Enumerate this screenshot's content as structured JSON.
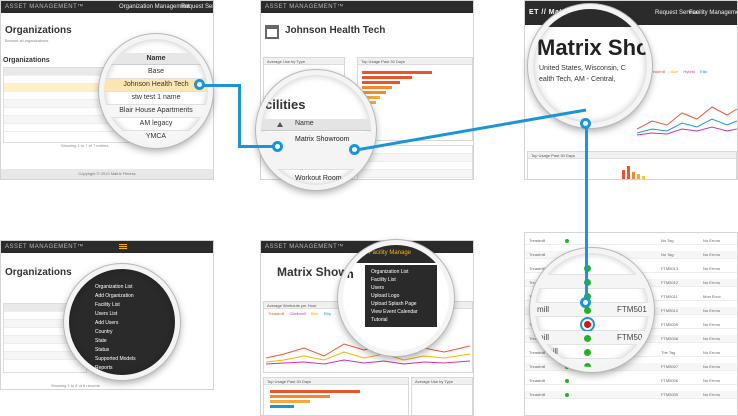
{
  "brand": "ASSET MANAGEMENT™",
  "accent": "#1c95d4",
  "panel1": {
    "title": "Organizations",
    "subtitle": "Browse all organizations",
    "table_title": "Organizations",
    "footer": "Copyright © 2013 Matrix Fitness",
    "showing": "Showing 1 to 7 of 7 entries",
    "nav": [
      "Organization Management",
      "Request Service"
    ],
    "lens": {
      "header": "Name",
      "items": [
        "Base",
        "Johnson Health Tech",
        "stw test 1 name",
        "Blair House Apartments",
        "AM legacy",
        "YMCA"
      ]
    }
  },
  "panel2": {
    "title": "Johnson Health Tech",
    "card1": "Average Use by Type",
    "card2": "Top Usage Past 30 Days",
    "lens": {
      "heading": "cilities",
      "col": "Name",
      "items": [
        "Matrix Showroom",
        "Workout Room"
      ]
    }
  },
  "panel3": {
    "crumb": "ET // Matrix Showroom",
    "nav": [
      "Request Service",
      "Facility Management"
    ],
    "card": "Top Usage Past 30 Days",
    "legend": [
      "Treadmill",
      "Bike",
      "Hybrid",
      "Ellip"
    ],
    "lens": {
      "title": "Matrix Sho",
      "line1": "United States, Wisconsin, C",
      "line2": "ealth Tech, AM - Central,"
    }
  },
  "panel4": {
    "title": "Organizations",
    "showing": "Showing 1 to 8 of 8 records",
    "menu": [
      "Organization List",
      "Add Organization",
      "Facility List",
      "Users List",
      "Add Users",
      "Country",
      "State",
      "Status",
      "Supported Models",
      "Reports"
    ]
  },
  "panel5": {
    "title": "Matrix Showroom",
    "card1": "Average Workouts per Hour",
    "card2": "Top Usage Past 30 Days",
    "card3": "Average Use by Type",
    "legend": [
      "Treadmill",
      "Climbmill",
      "Bike",
      "Ellip"
    ],
    "nav_partial": "ce",
    "nav_active": "Facility Manage",
    "menu": [
      "Organization List",
      "Facility List",
      "Users",
      "Upload Logo",
      "Upload Splash Page",
      "View Event Calendar",
      "Tutorial"
    ]
  },
  "panel6": {
    "rows": [
      {
        "type": "Treadmill",
        "tag": "No Tag",
        "status": "No Errors"
      },
      {
        "type": "Treadmill",
        "tag": "No Tag",
        "status": "No Errors"
      },
      {
        "type": "Treadmill",
        "tag": "FTM5013",
        "status": "No Errors"
      },
      {
        "type": "Treadmill",
        "tag": "FTM5012",
        "status": "No Errors"
      },
      {
        "type": "Treadmill",
        "tag": "FTM5011",
        "status": "Mon Error"
      },
      {
        "type": "Treadmill",
        "tag": "FTM5010",
        "status": "No Errors"
      },
      {
        "type": "Treadmill",
        "tag": "FTM5009",
        "status": "No Errors"
      },
      {
        "type": "Treadmill",
        "tag": "FTM5008",
        "status": "No Errors"
      },
      {
        "type": "Treadmill",
        "tag": "The Tag",
        "status": "No Errors"
      },
      {
        "type": "Treadmill",
        "tag": "FTM5007",
        "status": "No Errors"
      },
      {
        "type": "Treadmill",
        "tag": "FTM5006",
        "status": "No Errors"
      },
      {
        "type": "Treadmill",
        "tag": "FTM5005",
        "status": "No Errors"
      }
    ],
    "lens": {
      "partial": [
        "mill",
        "mill",
        "admill"
      ],
      "tags": [
        "FTM501",
        "FTM50",
        "FTM50"
      ]
    }
  }
}
